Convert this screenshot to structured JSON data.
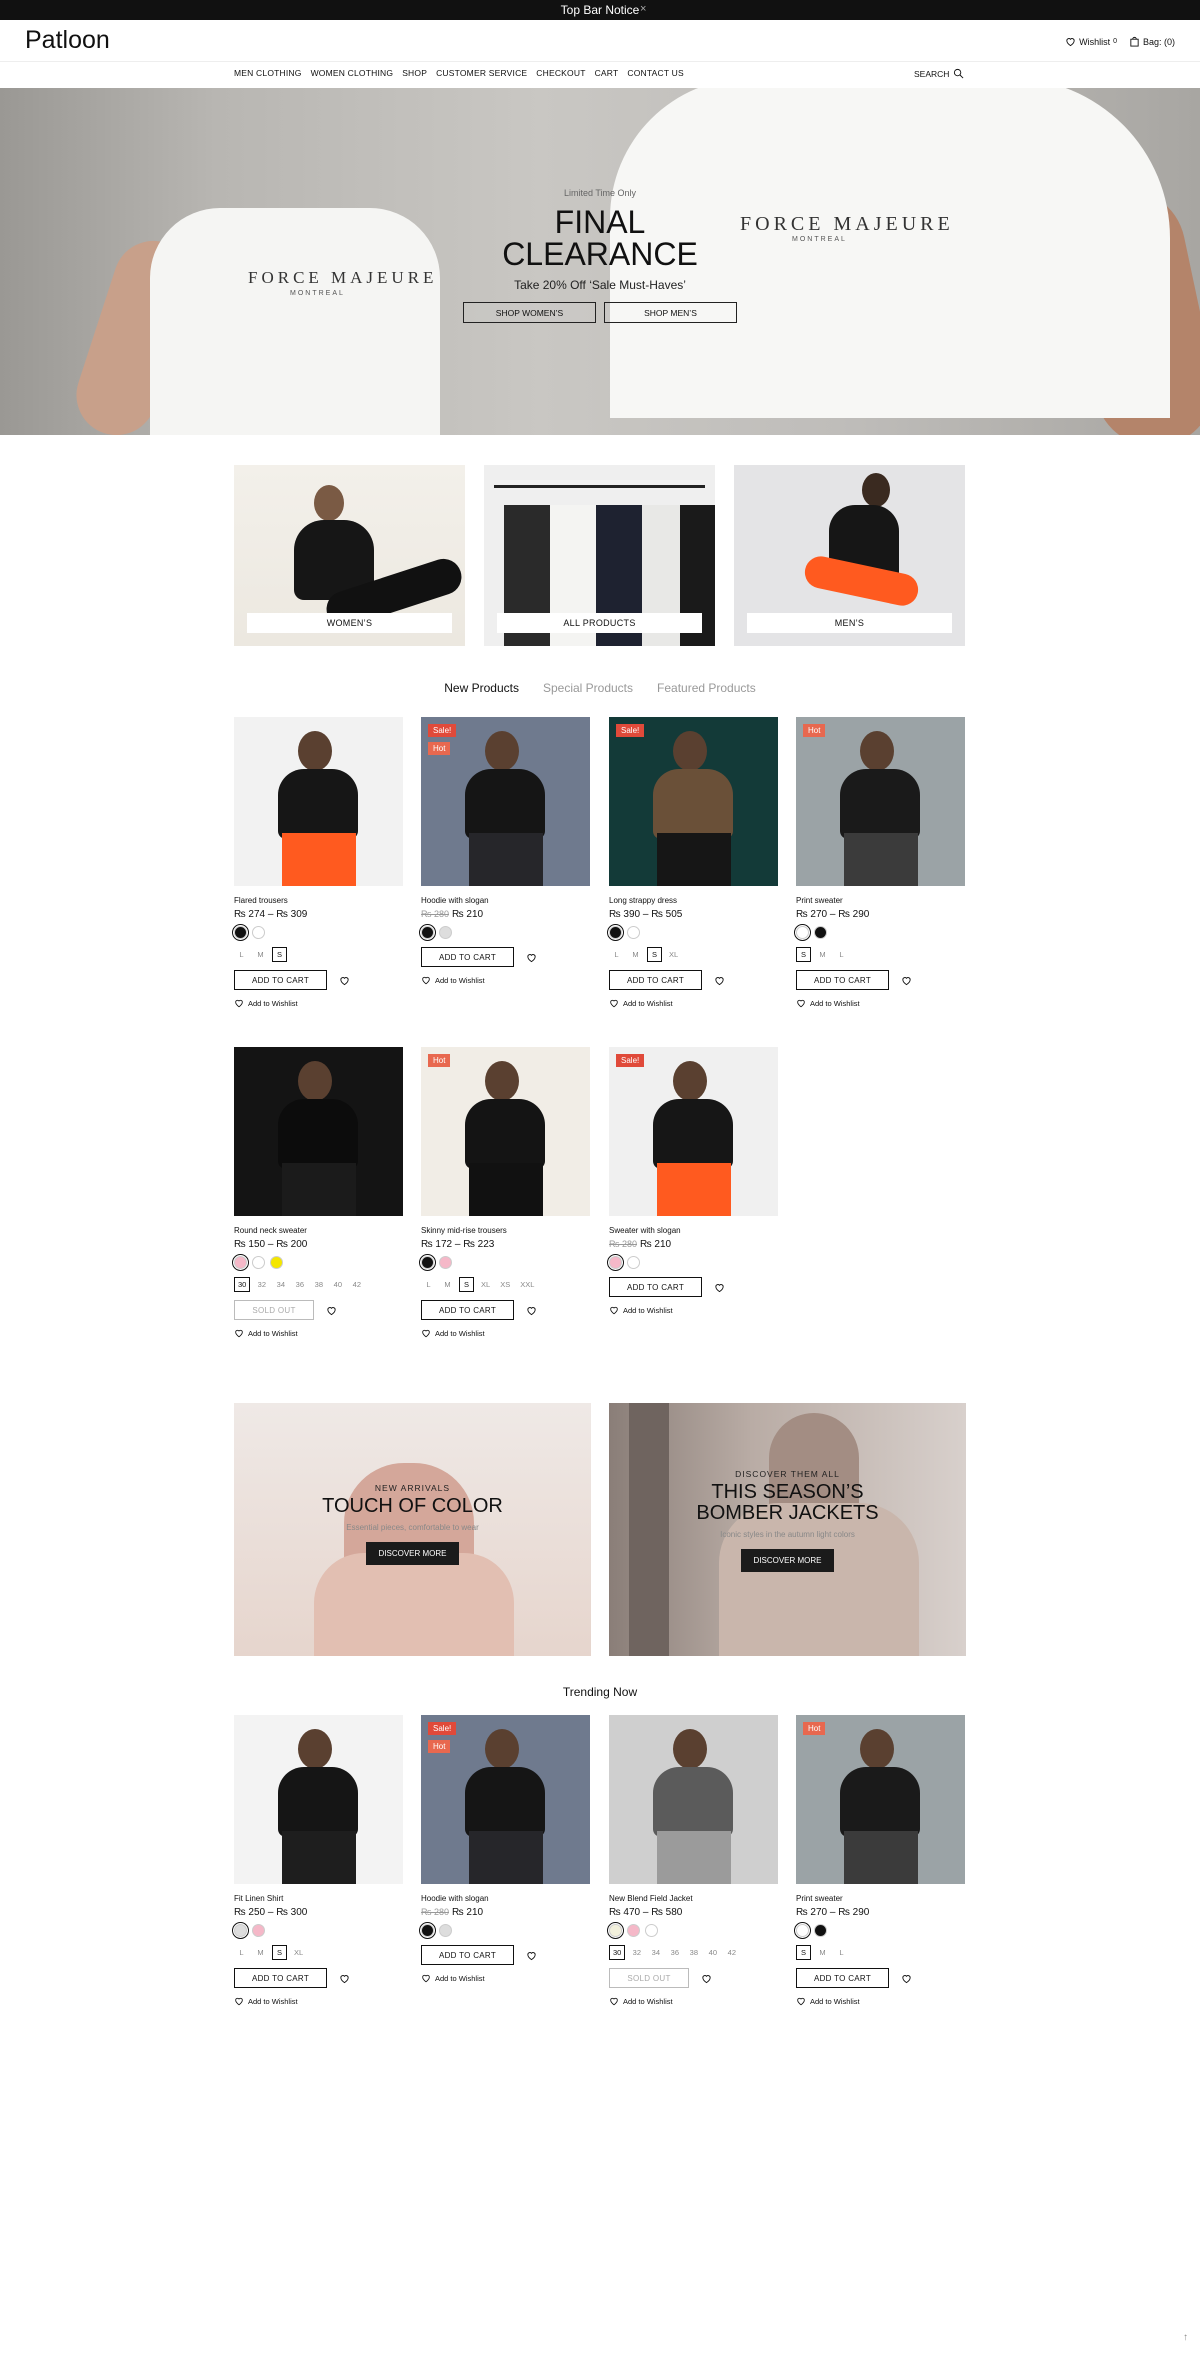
{
  "topbar": {
    "notice": "Top Bar Notice",
    "close": "×"
  },
  "header": {
    "logo": "Patloon",
    "wishlist": "Wishlist",
    "wishlist_count": "0",
    "bag": "Bag: (0)"
  },
  "nav": {
    "items": [
      "MEN CLOTHING",
      "WOMEN CLOTHING",
      "SHOP",
      "CUSTOMER SERVICE",
      "CHECKOUT",
      "CART",
      "CONTACT US"
    ],
    "search": "SEARCH"
  },
  "hero": {
    "eyebrow": "Limited Time Only",
    "title": "FINAL\nCLEARANCE",
    "subtitle": "Take 20% Off ‘Sale Must-Haves’",
    "buttons": [
      "SHOP WOMEN’S",
      "SHOP MEN’S"
    ],
    "shirt_brand": "FORCE MAJEURE",
    "shirt_sub": "MONTREAL"
  },
  "categories": [
    {
      "label": "WOMEN’S"
    },
    {
      "label": "ALL PRODUCTS"
    },
    {
      "label": "MEN’S"
    }
  ],
  "tabs": {
    "items": [
      "New Products",
      "Special Products",
      "Featured Products"
    ],
    "active": 0
  },
  "products": [
    {
      "name": "Flared trousers",
      "price": "₨ 274 – ₨ 309",
      "old": "",
      "badges": [],
      "swatches": [
        "#111111",
        "#ffffff"
      ],
      "sel_swatch": 0,
      "sizes": [
        "L",
        "M",
        "S"
      ],
      "sel_size": 2,
      "button": "ADD TO CART",
      "wish": "Add to Wishlist"
    },
    {
      "name": "Hoodie with slogan",
      "price": "₨ 210",
      "old": "₨ 280",
      "badges": [
        "Sale!",
        "Hot"
      ],
      "swatches": [
        "#111111",
        "#dddddd"
      ],
      "sel_swatch": 0,
      "sizes": [],
      "sel_size": -1,
      "button": "ADD TO CART",
      "wish": "Add to Wishlist"
    },
    {
      "name": "Long strappy dress",
      "price": "₨ 390 – ₨ 505",
      "old": "",
      "badges": [
        "Sale!"
      ],
      "swatches": [
        "#111111",
        "#ffffff"
      ],
      "sel_swatch": 0,
      "sizes": [
        "L",
        "M",
        "S",
        "XL"
      ],
      "sel_size": 2,
      "button": "ADD TO CART",
      "wish": "Add to Wishlist"
    },
    {
      "name": "Print sweater",
      "price": "₨ 270 – ₨ 290",
      "old": "",
      "badges": [
        "Hot"
      ],
      "swatches": [
        "#ffffff",
        "#111111"
      ],
      "sel_swatch": 0,
      "sizes": [
        "S",
        "M",
        "L"
      ],
      "sel_size": 0,
      "button": "ADD TO CART",
      "wish": "Add to Wishlist"
    },
    {
      "name": "Round neck sweater",
      "price": "₨ 150 – ₨ 200",
      "old": "",
      "badges": [],
      "swatches": [
        "#f5b8c8",
        "#ffffff",
        "#f4e600"
      ],
      "sel_swatch": 0,
      "sizes": [
        "30",
        "32",
        "34",
        "36",
        "38",
        "40",
        "42"
      ],
      "sel_size": 0,
      "button": "SOLD OUT",
      "wish": "Add to Wishlist"
    },
    {
      "name": "Skinny mid-rise trousers",
      "price": "₨ 172 – ₨ 223",
      "old": "",
      "badges": [
        "Hot"
      ],
      "swatches": [
        "#111111",
        "#f5b8c8"
      ],
      "sel_swatch": 0,
      "sizes": [
        "L",
        "M",
        "S",
        "XL",
        "XS",
        "XXL"
      ],
      "sel_size": 2,
      "button": "ADD TO CART",
      "wish": "Add to Wishlist"
    },
    {
      "name": "Sweater with slogan",
      "price": "₨ 210",
      "old": "₨ 280",
      "badges": [
        "Sale!"
      ],
      "swatches": [
        "#f5b8c8",
        "#ffffff"
      ],
      "sel_swatch": 0,
      "sizes": [],
      "sel_size": -1,
      "button": "ADD TO CART",
      "wish": "Add to Wishlist"
    }
  ],
  "banners": [
    {
      "eyebrow": "NEW ARRIVALS",
      "title": "TOUCH OF COLOR",
      "desc": "Essential pieces, comfortable to wear",
      "button": "DISCOVER MORE"
    },
    {
      "eyebrow": "DISCOVER THEM ALL",
      "title": "THIS SEASON’S\nBOMBER JACKETS",
      "desc": "Iconic styles in the autumn light colors",
      "button": "DISCOVER MORE"
    }
  ],
  "trending": {
    "title": "Trending Now",
    "products": [
      {
        "name": "Fit Linen Shirt",
        "price": "₨ 250 – ₨ 300",
        "old": "",
        "badges": [],
        "swatches": [
          "#dddddd",
          "#f5b8c8"
        ],
        "sel_swatch": 0,
        "sizes": [
          "L",
          "M",
          "S",
          "XL"
        ],
        "sel_size": 2,
        "button": "ADD TO CART",
        "wish": "Add to Wishlist"
      },
      {
        "name": "Hoodie with slogan",
        "price": "₨ 210",
        "old": "₨ 280",
        "badges": [
          "Sale!",
          "Hot"
        ],
        "swatches": [
          "#111111",
          "#dddddd"
        ],
        "sel_swatch": 0,
        "sizes": [],
        "sel_size": -1,
        "button": "ADD TO CART",
        "wish": "Add to Wishlist"
      },
      {
        "name": "New Blend Field Jacket",
        "price": "₨ 470 – ₨ 580",
        "old": "",
        "badges": [],
        "swatches": [
          "#f2f0dc",
          "#f5b8c8",
          "#ffffff"
        ],
        "sel_swatch": 0,
        "sizes": [
          "30",
          "32",
          "34",
          "36",
          "38",
          "40",
          "42"
        ],
        "sel_size": 0,
        "button": "SOLD OUT",
        "wish": "Add to Wishlist"
      },
      {
        "name": "Print sweater",
        "price": "₨ 270 – ₨ 290",
        "old": "",
        "badges": [
          "Hot"
        ],
        "swatches": [
          "#ffffff",
          "#111111"
        ],
        "sel_swatch": 0,
        "sizes": [
          "S",
          "M",
          "L"
        ],
        "sel_size": 0,
        "button": "ADD TO CART",
        "wish": "Add to Wishlist"
      }
    ]
  },
  "back_to_top": "↑"
}
